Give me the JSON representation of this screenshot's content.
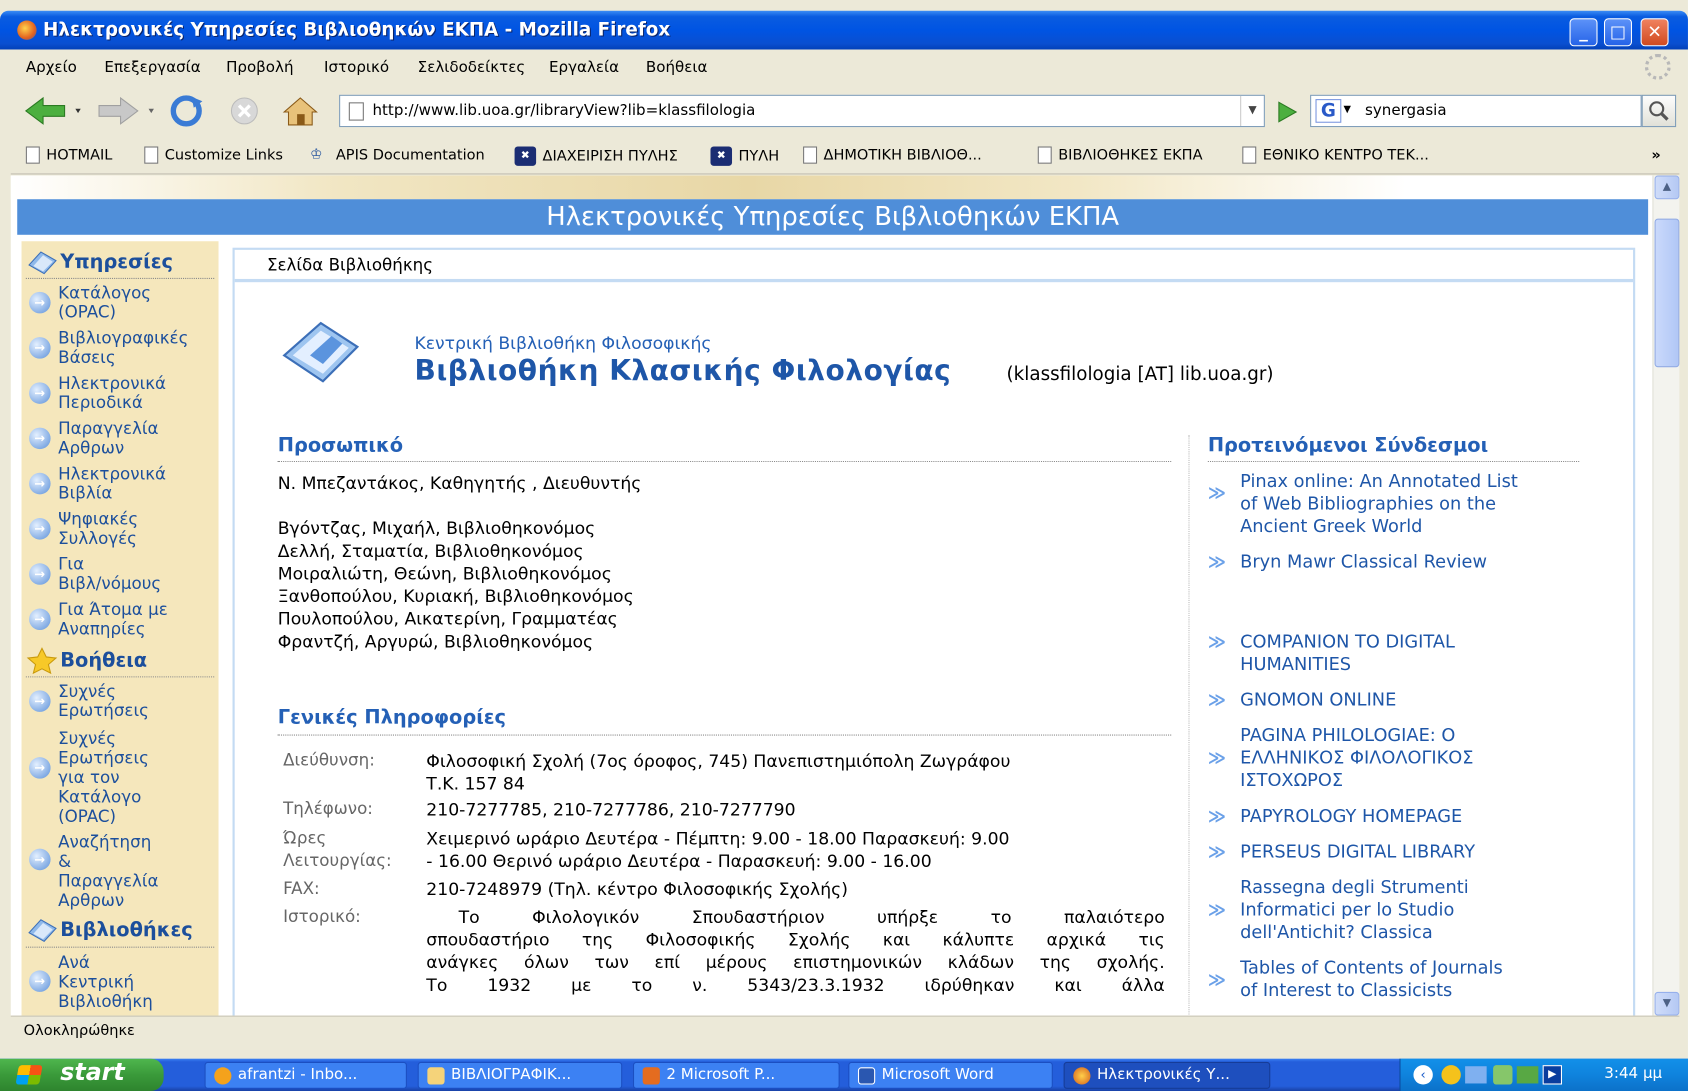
{
  "window": {
    "title": "Ηλεκτρονικές Υπηρεσίες Βιβλιοθηκών ΕΚΠΑ - Mozilla Firefox",
    "min_label": "_",
    "max_label": "□",
    "close_label": "✕"
  },
  "menubar": [
    "Αρχείο",
    "Επεξεργασία",
    "Προβολή",
    "Ιστορικό",
    "Σελιδοδείκτες",
    "Εργαλεία",
    "Βοήθεια"
  ],
  "navbar": {
    "url": "http://www.lib.uoa.gr/libraryView?lib=klassfilologia",
    "search_value": "synergasia",
    "search_engine_letter": "G"
  },
  "bookmarks": [
    "HOTMAIL",
    "Customize Links",
    "APIS Documentation",
    "ΔΙΑΧΕΙΡΙΣΗ ΠΥΛΗΣ",
    "ΠΥΛΗ",
    "ΔΗΜΟΤΙΚΗ ΒΙΒΛΙΟΘ...",
    "ΒΙΒΛΙΟΘΗΚΕΣ ΕΚΠΑ",
    "ΕΘΝΙΚΟ ΚΕΝΤΡΟ ΤΕΚ..."
  ],
  "bookmarks_more": "»",
  "page": {
    "banner": "Ηλεκτρονικές Υπηρεσίες Βιβλιοθηκών ΕΚΠΑ",
    "sidebar": {
      "services_title": "Υπηρεσίες",
      "services": [
        [
          "Κατάλογος",
          "(OPAC)"
        ],
        [
          "Βιβλιογραφικές",
          "Βάσεις"
        ],
        [
          "Ηλεκτρονικά",
          "Περιοδικά"
        ],
        [
          "Παραγγελία",
          "Αρθρων"
        ],
        [
          "Ηλεκτρονικά",
          "Βιβλία"
        ],
        [
          "Ψηφιακές",
          "Συλλογές"
        ],
        [
          "Για",
          "Βιβλ/νόμους"
        ],
        [
          "Για Άτομα με",
          "Αναπηρίες"
        ]
      ],
      "help_title": "Βοήθεια",
      "help": [
        [
          "Συχνές",
          "Ερωτήσεις"
        ],
        [
          "Συχνές",
          "Ερωτήσεις",
          "για τον",
          "Κατάλογο",
          "(OPAC)"
        ],
        [
          "Αναζήτηση",
          "&",
          "Παραγγελία",
          "Αρθρων"
        ]
      ],
      "libraries_title": "Βιβλιοθήκες",
      "libraries": [
        [
          "Ανά",
          "Κεντρική",
          "Βιβλιοθήκη"
        ]
      ]
    },
    "panel_title": "Σελίδα Βιβλιοθήκης",
    "library": {
      "parent": "Κεντρική Βιβλιοθήκη Φιλοσοφικής",
      "name": "Βιβλιοθήκη Κλασικής Φιλολογίας",
      "email": "(klassfilologia [AT] lib.uoa.gr)"
    },
    "staff_title": "Προσωπικό",
    "director": "Ν. Μπεζαντάκος, Καθηγητής , Διευθυντής",
    "staff": [
      "Βγόντζας, Μιχαήλ, Βιβλιοθηκονόμος",
      "Δελλή, Σταματία, Βιβλιοθηκονόμος",
      "Μοιραλιώτη, Θεώνη, Βιβλιοθηκονόμος",
      "Ξανθοπούλου, Κυριακή, Βιβλιοθηκονόμος",
      "Πουλοπούλου, Αικατερίνη, Γραμματέας",
      "Φραντζή, Αργυρώ, Βιβλιοθηκονόμος"
    ],
    "general_title": "Γενικές Πληροφορίες",
    "info": {
      "address_label": "Διεύθυνση:",
      "address": [
        "Φιλοσοφική Σχολή (7ος όροφος, 745) Πανεπιστημιόπολη Ζωγράφου",
        "Τ.Κ. 157 84"
      ],
      "phone_label": "Τηλέφωνο:",
      "phone": "210-7277785, 210-7277786, 210-7277790",
      "hours_label": [
        "Ώρες",
        "Λειτουργίας:"
      ],
      "hours": [
        "Χειμερινό ωράριο Δευτέρα - Πέμπτη: 9.00 - 18.00 Παρασκευή: 9.00",
        "- 16.00 Θερινό ωράριο Δευτέρα - Παρασκευή: 9.00 - 16.00"
      ],
      "fax_label": "FAX:",
      "fax": "210-7248979 (Τηλ. κέντρο Φιλοσοφικής Σχολής)",
      "history_label": "Ιστορικό:",
      "history": [
        "Το Φιλολογικόν Σπουδαστήριον υπήρξε το παλαιότερο",
        "σπουδαστήριο της Φιλοσοφικής Σχολής και κάλυπτε αρχικά τις",
        "ανάγκες όλων των επί μέρους επιστημονικών κλάδων της σχολής.",
        "Το 1932 με το ν. 5343/23.3.1932 ιδρύθηκαν και άλλα"
      ]
    },
    "links_title": "Προτεινόμενοι Σύνδεσμοι",
    "links": [
      [
        "Pinax online: An Annotated List",
        "of Web Bibliographies on the",
        "Ancient Greek World"
      ],
      [
        "Bryn Mawr Classical Review"
      ],
      [
        "COMPANION TO DIGITAL",
        "HUMANITIES"
      ],
      [
        "GNOMON ONLINE"
      ],
      [
        "PAGINA PHILOLOGIAE: O",
        "ΕΛΛΗΝΙΚΟΣ ΦΙΛΟΛΟΓΙΚΟΣ",
        "ΙΣΤΟΧΩΡΟΣ"
      ],
      [
        "PAPYROLOGY HOMEPAGE"
      ],
      [
        "PERSEUS DIGITAL LIBRARY"
      ],
      [
        "Rassegna degli Strumenti",
        "Informatici per lo Studio",
        "dell'Antichit? Classica"
      ],
      [
        "Tables of Contents of Journals",
        "of Interest to Classicists"
      ]
    ]
  },
  "statusbar": "Ολοκληρώθηκε",
  "taskbar": {
    "start": "start",
    "tasks": [
      "afrantzi - Inbo...",
      "ΒΙΒΛΙΟΓΡΑΦΙΚ...",
      "2 Microsoft P...",
      "Microsoft Word",
      "Ηλεκτρονικές Υ..."
    ],
    "time": "3:44 μμ"
  },
  "colors": {
    "accent": "#1e56a8",
    "banner": "#4f8ed9",
    "sidebar_bg": "#f5e7bc",
    "panel_border": "#c4dbf3"
  }
}
